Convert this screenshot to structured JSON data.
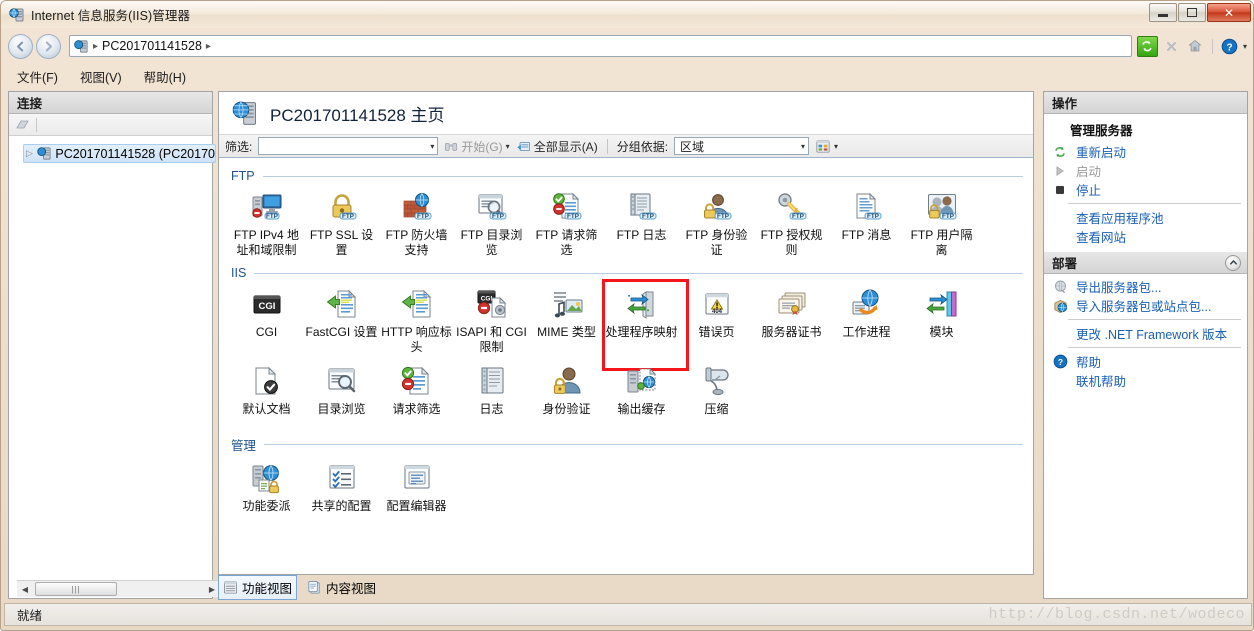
{
  "window": {
    "title": "Internet 信息服务(IIS)管理器",
    "title_icon": "iis-server-icon",
    "minimize_label": "最小化",
    "maximize_label": "最大化",
    "close_label": "✕"
  },
  "addressbar": {
    "back_glyph": "◀",
    "forward_glyph": "▶",
    "server_icon": "iis-server-icon",
    "path_label": "PC201701141528",
    "separator": "▸",
    "tools": [
      "refresh-icon",
      "stop-icon",
      "home-icon",
      "help-icon",
      "help-dropdown-icon"
    ]
  },
  "menubar": {
    "items": [
      {
        "label": "文件(F)"
      },
      {
        "label": "视图(V)"
      },
      {
        "label": "帮助(H)"
      }
    ]
  },
  "connections": {
    "header": "连接",
    "toolbar_icon": "connect-to-server-icon",
    "tree": [
      {
        "label": "PC201701141528 (PC20170",
        "icon": "server-icon",
        "expander": "▷",
        "selected": true
      }
    ],
    "scroll_left_arrow": "◀",
    "scroll_right_arrow": "▶",
    "scroll_thumb_grip": "|||"
  },
  "main": {
    "page_icon": "server-home-icon",
    "page_title": "PC201701141528 主页",
    "filter": {
      "label": "筛选:",
      "value": "",
      "placeholder": "",
      "dropdown_caret": "▾",
      "go_label": "开始(G)",
      "go_icon": "binoculars-icon",
      "go_caret": "▾",
      "showall_label": "全部显示(A)",
      "showall_icon": "show-all-icon",
      "groupby_label": "分组依据:",
      "groupby_value": "区域",
      "groupby_caret": "▾",
      "viewmode_icon": "view-mode-icon",
      "viewmode_caret": "▾"
    },
    "groups": [
      {
        "name": "FTP",
        "items": [
          {
            "label": "FTP IPv4 地址和域限制",
            "icon": "ftp-ipv4-restrictions-icon"
          },
          {
            "label": "FTP SSL 设置",
            "icon": "ftp-ssl-settings-icon"
          },
          {
            "label": "FTP 防火墙支持",
            "icon": "ftp-firewall-support-icon"
          },
          {
            "label": "FTP 目录浏览",
            "icon": "ftp-directory-browsing-icon"
          },
          {
            "label": "FTP 请求筛选",
            "icon": "ftp-request-filtering-icon"
          },
          {
            "label": "FTP 日志",
            "icon": "ftp-logging-icon"
          },
          {
            "label": "FTP 身份验证",
            "icon": "ftp-authentication-icon"
          },
          {
            "label": "FTP 授权规则",
            "icon": "ftp-authorization-rules-icon"
          },
          {
            "label": "FTP 消息",
            "icon": "ftp-messages-icon"
          },
          {
            "label": "FTP 用户隔离",
            "icon": "ftp-user-isolation-icon"
          }
        ]
      },
      {
        "name": "IIS",
        "items": [
          {
            "label": "CGI",
            "icon": "cgi-icon"
          },
          {
            "label": "FastCGI 设置",
            "icon": "fastcgi-settings-icon"
          },
          {
            "label": "HTTP 响应标头",
            "icon": "http-response-headers-icon"
          },
          {
            "label": "ISAPI 和 CGI 限制",
            "icon": "isapi-cgi-restrictions-icon"
          },
          {
            "label": "MIME 类型",
            "icon": "mime-types-icon"
          },
          {
            "label": "处理程序映射",
            "icon": "handler-mappings-icon",
            "highlighted": true
          },
          {
            "label": "错误页",
            "icon": "error-pages-icon"
          },
          {
            "label": "服务器证书",
            "icon": "server-certificates-icon"
          },
          {
            "label": "工作进程",
            "icon": "worker-processes-icon"
          },
          {
            "label": "模块",
            "icon": "modules-icon"
          },
          {
            "label": "默认文档",
            "icon": "default-document-icon"
          },
          {
            "label": "目录浏览",
            "icon": "directory-browsing-icon"
          },
          {
            "label": "请求筛选",
            "icon": "request-filtering-icon"
          },
          {
            "label": "日志",
            "icon": "logging-icon"
          },
          {
            "label": "身份验证",
            "icon": "authentication-icon"
          },
          {
            "label": "输出缓存",
            "icon": "output-caching-icon"
          },
          {
            "label": "压缩",
            "icon": "compression-icon"
          }
        ]
      },
      {
        "name": "管理",
        "items": [
          {
            "label": "功能委派",
            "icon": "feature-delegation-icon"
          },
          {
            "label": "共享的配置",
            "icon": "shared-configuration-icon"
          },
          {
            "label": "配置编辑器",
            "icon": "configuration-editor-icon"
          }
        ]
      }
    ],
    "view_tabs": [
      {
        "label": "功能视图",
        "icon": "features-view-icon",
        "active": true
      },
      {
        "label": "内容视图",
        "icon": "content-view-icon",
        "active": false
      }
    ]
  },
  "actions": {
    "header": "操作",
    "groups": [
      {
        "title": "管理服务器",
        "items": [
          {
            "label": "重新启动",
            "icon": "restart-icon",
            "disabled": false
          },
          {
            "label": "启动",
            "icon": "start-icon",
            "disabled": true
          },
          {
            "label": "停止",
            "icon": "stop-square-icon",
            "disabled": false
          }
        ],
        "rule_after": true,
        "extra_items": [
          {
            "label": "查看应用程序池",
            "icon": "",
            "disabled": false
          },
          {
            "label": "查看网站",
            "icon": "",
            "disabled": false
          }
        ]
      }
    ],
    "deploy": {
      "title": "部署",
      "collapse_icon": "chevron-up-icon",
      "items": [
        {
          "label": "导出服务器包...",
          "icon": "export-package-icon"
        },
        {
          "label": "导入服务器包或站点包...",
          "icon": "import-package-icon"
        }
      ],
      "rule_after": true,
      "extra_items": [
        {
          "label": "更改 .NET Framework 版本",
          "icon": ""
        }
      ]
    },
    "help": {
      "items": [
        {
          "label": "帮助",
          "icon": "help-circle-icon"
        },
        {
          "label": "联机帮助",
          "icon": ""
        }
      ]
    }
  },
  "statusbar": {
    "text": "就绪",
    "watermark": "http://blog.csdn.net/wodeco"
  },
  "colors": {
    "accent_link": "#1a5fb4",
    "group_title": "#20538d",
    "highlight_border": "#f5161c",
    "selection": "#cfe3f7"
  }
}
